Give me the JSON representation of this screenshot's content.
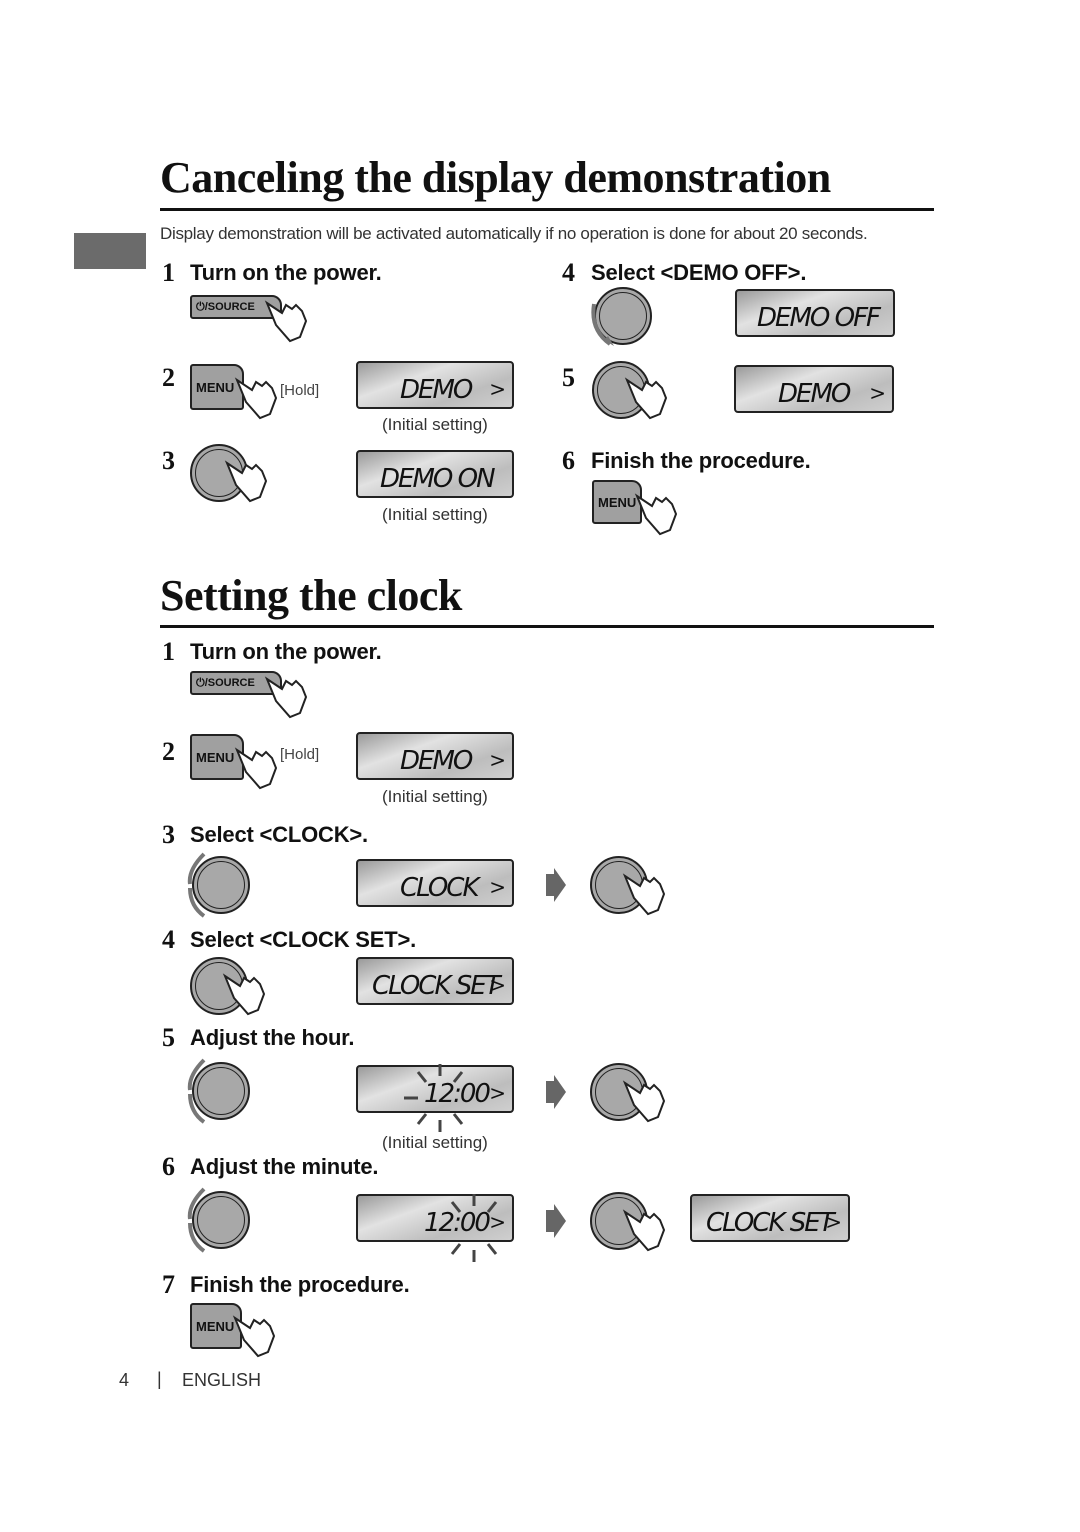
{
  "section1": {
    "title": "Canceling the display demonstration",
    "intro": "Display demonstration will be activated automatically if no operation is done for about 20 seconds.",
    "steps": [
      {
        "num": "1",
        "title": "Turn on the power.",
        "button": "⏻/SOURCE"
      },
      {
        "num": "2",
        "button": "MENU",
        "hold": "[Hold]",
        "display": "DEMO",
        "display_arrow": ">",
        "note": "(Initial setting)"
      },
      {
        "num": "3",
        "display": "DEMO ON",
        "note": "(Initial setting)"
      },
      {
        "num": "4",
        "title": "Select <DEMO OFF>.",
        "display": "DEMO OFF"
      },
      {
        "num": "5",
        "display": "DEMO",
        "display_arrow": ">"
      },
      {
        "num": "6",
        "title": "Finish the procedure.",
        "button": "MENU"
      }
    ]
  },
  "section2": {
    "title": "Setting the clock",
    "steps": [
      {
        "num": "1",
        "title": "Turn on the power.",
        "button": "⏻/SOURCE"
      },
      {
        "num": "2",
        "button": "MENU",
        "hold": "[Hold]",
        "display": "DEMO",
        "display_arrow": ">",
        "note": "(Initial setting)"
      },
      {
        "num": "3",
        "title": "Select <CLOCK>.",
        "display": "CLOCK",
        "display_arrow": ">"
      },
      {
        "num": "4",
        "title": "Select <CLOCK SET>.",
        "display": "CLOCK SET",
        "display_arrow": ">"
      },
      {
        "num": "5",
        "title": "Adjust the hour.",
        "display": "12:00",
        "display_arrow": ">",
        "note": "(Initial setting)"
      },
      {
        "num": "6",
        "title": "Adjust the minute.",
        "display": "12:00",
        "display_arrow": ">",
        "display2": "CLOCK SET",
        "display2_arrow": ">"
      },
      {
        "num": "7",
        "title": "Finish the procedure.",
        "button": "MENU"
      }
    ]
  },
  "footer": {
    "page": "4",
    "separator": "|",
    "language": "ENGLISH"
  }
}
